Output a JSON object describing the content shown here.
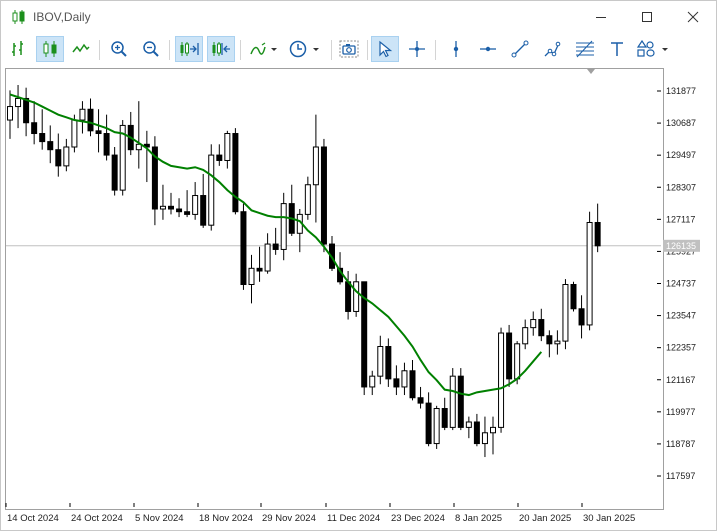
{
  "window": {
    "title": "IBOV,Daily",
    "controls": [
      "minimize",
      "maximize",
      "close"
    ]
  },
  "toolbar": {
    "buttons": [
      {
        "icon": "bar-chart-icon",
        "active": false
      },
      {
        "icon": "candlestick-chart-icon",
        "active": true
      },
      {
        "icon": "line-chart-icon",
        "active": false
      },
      {
        "icon": "zoom-in-icon",
        "active": false
      },
      {
        "icon": "zoom-out-icon",
        "active": false
      },
      {
        "icon": "auto-scroll-icon",
        "active": true
      },
      {
        "icon": "chart-shift-icon",
        "active": true
      },
      {
        "icon": "indicators-icon",
        "active": false
      },
      {
        "icon": "periods-clock-icon",
        "active": false
      },
      {
        "icon": "screenshot-camera-icon",
        "active": false
      },
      {
        "icon": "cursor-arrow-icon",
        "active": true
      },
      {
        "icon": "crosshair-icon",
        "active": false
      },
      {
        "icon": "vertical-line-icon",
        "active": false
      },
      {
        "icon": "horizontal-line-icon",
        "active": false
      },
      {
        "icon": "trendline-icon",
        "active": false
      },
      {
        "icon": "equidistant-channel-icon",
        "active": false
      },
      {
        "icon": "fibonacci-icon",
        "active": false
      },
      {
        "icon": "text-tool-icon",
        "active": false
      },
      {
        "icon": "shapes-icon",
        "active": false
      }
    ]
  },
  "chart_data": {
    "type": "candlestick",
    "symbol": "IBOV",
    "period": "Daily",
    "ylim": [
      116800,
      132500
    ],
    "y_ticks": [
      131877,
      130687,
      129497,
      128307,
      127117,
      125927,
      124737,
      123547,
      122357,
      121167,
      119977,
      118787,
      117597
    ],
    "x_ticks": [
      "14 Oct 2024",
      "24 Oct 2024",
      "5 Nov 2024",
      "18 Nov 2024",
      "29 Nov 2024",
      "11 Dec 2024",
      "23 Dec 2024",
      "8 Jan 2025",
      "20 Jan 2025",
      "30 Jan 2025"
    ],
    "current_price": "126135",
    "bull_color": "#ffffff",
    "bear_color": "#000000",
    "ma_color": "#008000",
    "grid": false,
    "candles": [
      [
        130800,
        131900,
        130100,
        131300
      ],
      [
        131300,
        132100,
        130500,
        131600
      ],
      [
        131600,
        132000,
        130200,
        130700
      ],
      [
        130700,
        131500,
        129900,
        130300
      ],
      [
        130300,
        131200,
        129700,
        130000
      ],
      [
        130000,
        130600,
        129200,
        129700
      ],
      [
        129700,
        130300,
        128700,
        129100
      ],
      [
        129100,
        130100,
        128900,
        129800
      ],
      [
        129800,
        131000,
        129600,
        130800
      ],
      [
        130800,
        131500,
        130300,
        131200
      ],
      [
        131200,
        131600,
        130200,
        130400
      ],
      [
        130400,
        131200,
        129600,
        130300
      ],
      [
        130300,
        131000,
        129300,
        129500
      ],
      [
        129500,
        129800,
        128000,
        128200
      ],
      [
        128200,
        130800,
        128000,
        130600
      ],
      [
        130600,
        131100,
        129500,
        129700
      ],
      [
        129700,
        131500,
        129000,
        129900
      ],
      [
        129900,
        130400,
        128500,
        129800
      ],
      [
        129800,
        130200,
        126900,
        127500
      ],
      [
        127500,
        128400,
        127100,
        127600
      ],
      [
        127600,
        128100,
        127300,
        127500
      ],
      [
        127500,
        127900,
        127200,
        127400
      ],
      [
        127400,
        128200,
        127200,
        127300
      ],
      [
        127300,
        128500,
        127100,
        128000
      ],
      [
        128000,
        128800,
        126800,
        126900
      ],
      [
        126900,
        129900,
        126700,
        129500
      ],
      [
        129500,
        129900,
        129100,
        129300
      ],
      [
        129300,
        130400,
        129000,
        130300
      ],
      [
        130300,
        130500,
        127300,
        127400
      ],
      [
        127400,
        127700,
        124500,
        124700
      ],
      [
        124700,
        125800,
        124000,
        125300
      ],
      [
        125300,
        126100,
        124800,
        125200
      ],
      [
        125200,
        126600,
        125100,
        126200
      ],
      [
        126200,
        126800,
        125800,
        126000
      ],
      [
        126000,
        128100,
        125600,
        127700
      ],
      [
        127700,
        128400,
        126500,
        126600
      ],
      [
        126600,
        127500,
        125900,
        127300
      ],
      [
        127300,
        128700,
        127100,
        128400
      ],
      [
        128400,
        131000,
        127000,
        129800
      ],
      [
        129800,
        130100,
        125900,
        126200
      ],
      [
        126200,
        126500,
        125200,
        125300
      ],
      [
        125300,
        125900,
        124700,
        124800
      ],
      [
        124800,
        125200,
        123400,
        123700
      ],
      [
        123700,
        125100,
        123500,
        124800
      ],
      [
        124800,
        124800,
        120600,
        120900
      ],
      [
        120900,
        121500,
        120600,
        121300
      ],
      [
        121300,
        122800,
        121000,
        122400
      ],
      [
        122400,
        122700,
        120900,
        121200
      ],
      [
        121200,
        121700,
        120600,
        120900
      ],
      [
        120900,
        121800,
        120600,
        121500
      ],
      [
        121500,
        121900,
        120400,
        120500
      ],
      [
        120500,
        120900,
        120100,
        120300
      ],
      [
        120300,
        120700,
        118700,
        118800
      ],
      [
        118800,
        120200,
        118600,
        120100
      ],
      [
        120100,
        120500,
        119300,
        119400
      ],
      [
        119400,
        121600,
        119300,
        121300
      ],
      [
        121300,
        121600,
        119300,
        119400
      ],
      [
        119400,
        119800,
        119000,
        119600
      ],
      [
        119600,
        119900,
        118700,
        118800
      ],
      [
        118800,
        119800,
        118300,
        119200
      ],
      [
        119200,
        119800,
        118400,
        119400
      ],
      [
        119400,
        123100,
        119200,
        122900
      ],
      [
        122900,
        123200,
        120900,
        121200
      ],
      [
        121200,
        122600,
        121000,
        122500
      ],
      [
        122500,
        123400,
        122300,
        123100
      ],
      [
        123100,
        123700,
        122800,
        123400
      ],
      [
        123400,
        123800,
        122600,
        122800
      ],
      [
        122800,
        123000,
        122000,
        122500
      ],
      [
        122500,
        123000,
        122100,
        122600
      ],
      [
        122600,
        124900,
        122300,
        124700
      ],
      [
        124700,
        124800,
        123700,
        123800
      ],
      [
        123800,
        124300,
        122700,
        123200
      ],
      [
        123200,
        127400,
        123000,
        127000
      ],
      [
        127000,
        127700,
        125900,
        126135
      ]
    ],
    "ma": [
      131750,
      131650,
      131550,
      131450,
      131300,
      131150,
      131000,
      130900,
      130800,
      130750,
      130700,
      130600,
      130500,
      130350,
      130300,
      130150,
      129950,
      129750,
      129450,
      129250,
      129100,
      129050,
      129000,
      129050,
      128950,
      128750,
      128500,
      128200,
      127950,
      127750,
      127450,
      127350,
      127250,
      127200,
      127200,
      127150,
      127050,
      126700,
      126450,
      126100,
      125700,
      125200,
      124800,
      124450,
      124200,
      124000,
      123750,
      123500,
      123150,
      122800,
      122400,
      121900,
      121450,
      121150,
      120800,
      120750,
      120650,
      120600,
      120700,
      120750,
      120800,
      120850,
      121000,
      121200,
      121500,
      121850,
      122200
    ]
  }
}
